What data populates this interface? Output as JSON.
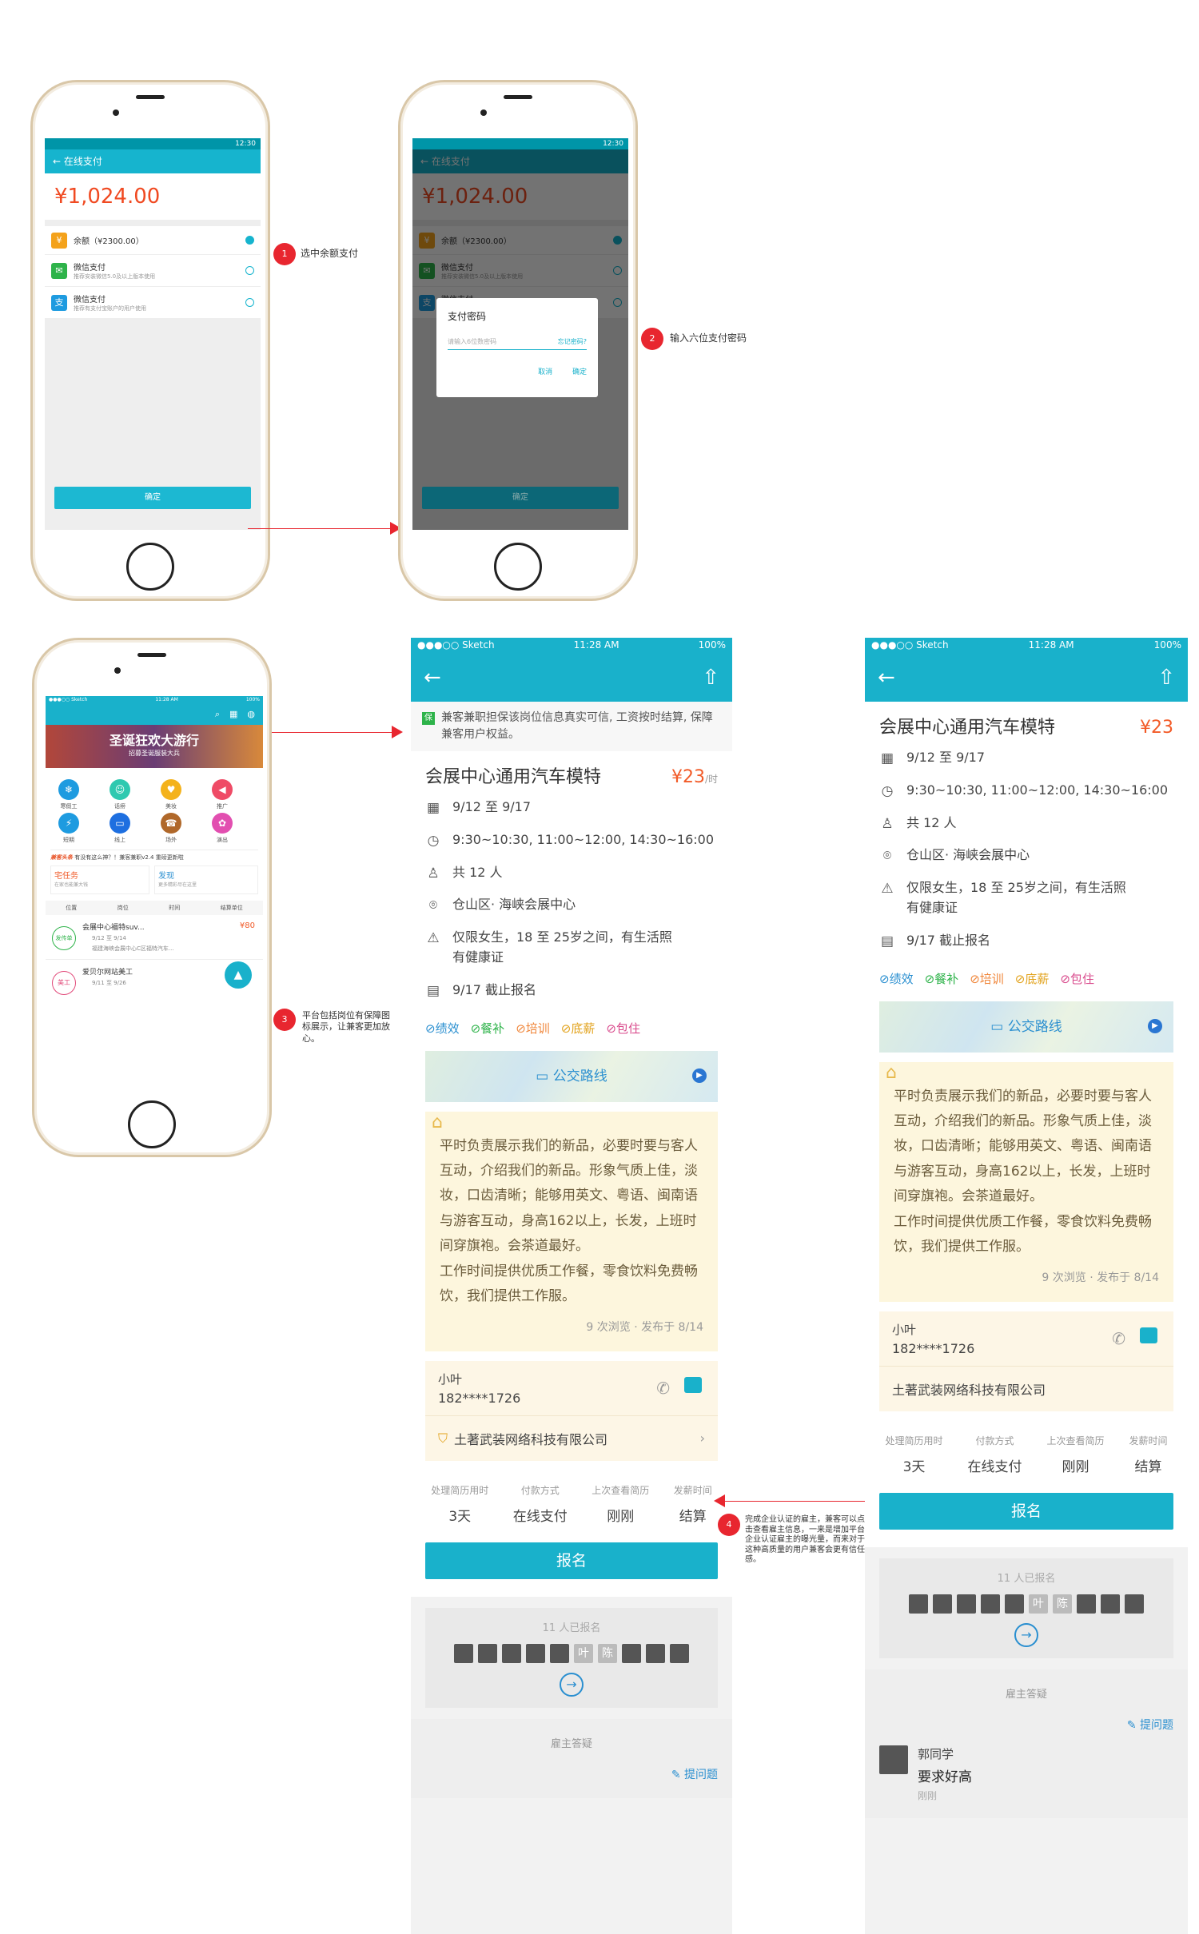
{
  "screen1": {
    "status_time": "12:30",
    "title": "在线支付",
    "amount": "¥1,024.00",
    "balance": "余额（¥2300.00）",
    "wechat": "微信支付",
    "wechat_sub": "推荐安装微信5.0及以上版本使用",
    "alipay": "微信支付",
    "alipay_sub": "推荐有支付宝账户的用户使用",
    "confirm": "确定"
  },
  "dialog": {
    "title": "支付密码",
    "placeholder": "请输入6位数密码",
    "forgot": "忘记密码?",
    "cancel": "取消",
    "ok": "确定"
  },
  "annotations": {
    "a1_num": "1",
    "a1": "选中余额支付",
    "a2_num": "2",
    "a2": "输入六位支付密码",
    "a3_num": "3",
    "a3": "平台包括岗位有保障图标展示，让兼客更加放心。",
    "a4_num": "4",
    "a4": "完成企业认证的雇主，兼客可以点击查看雇主信息，一来是增加平台企业认证雇主的曝光量，而来对于这种高质量的用户兼客会更有信任感。"
  },
  "home": {
    "status_left": "●●●○○ Sketch",
    "status_time": "11:28 AM",
    "status_batt": "100%",
    "banner": "圣诞狂欢大游行",
    "banner_sub": "招募圣诞服装大兵",
    "cats": [
      "寒假工",
      "话痨",
      "美妆",
      "推广",
      "短期",
      "线上",
      "场外",
      "演出"
    ],
    "headline_tag": "兼客头条",
    "headline": "有没有这么神？！兼客兼职v2.4 重磅更新啦",
    "zhai": "宅任务",
    "zhai_sub": "在家也能兼大钱",
    "faxian": "发现",
    "faxian_sub": "更多精彩尽在这里",
    "filters": [
      "位置",
      "岗位",
      "时间",
      "结算单位"
    ],
    "job1_title": "会展中心福特suv...",
    "job1_price": "¥80",
    "job1_date": "9/12 至 9/14",
    "job1_loc": "福建海峡会展中心C区福特汽车...",
    "job1_avatar": "发传单",
    "job2_title": "爱贝尔网站美工",
    "job2_date": "9/11 至 9/26",
    "job2_avatar": "美工"
  },
  "detail": {
    "status_left": "●●●○○ Sketch",
    "status_time": "11:28 AM",
    "status_batt": "100%",
    "guarantee": "兼客兼职担保该岗位信息真实可信, 工资按时结算, 保障兼客用户权益。",
    "guarantee_icon": "保",
    "title": "会展中心通用汽车模特",
    "price": "¥23",
    "price_unit": "/时",
    "date": "9/12 至 9/17",
    "time": "9:30~10:30, 11:00~12:00, 14:30~16:00",
    "people": "共 12 人",
    "location": "仓山区· 海峡会展中心",
    "req": "仅限女生，18 至 25岁之间，有生活照有健康证",
    "deadline": "9/17 截止报名",
    "tags": [
      "绩效",
      "餐补",
      "培训",
      "底薪",
      "包住"
    ],
    "tag_colors": [
      "#2a8fd0",
      "#2eb34a",
      "#f0863a",
      "#e2a21b",
      "#d94a8c"
    ],
    "map": "公交路线",
    "desc1": "平时负责展示我们的新品，必要时要与客人互动，介绍我们的新品。形象气质上佳，淡妆，口齿清晰；能够用英文、粤语、闽南语与游客互动，身高162以上，长发，上班时间穿旗袍。会茶道最好。",
    "desc2": "工作时间提供优质工作餐，零食饮料免费畅饮，我们提供工作服。",
    "meta": "9 次浏览 · 发布于 8/14",
    "contact_name": "小叶",
    "contact_phone": "182****1726",
    "company": "土著武装网络科技有限公司",
    "stats_labels": [
      "处理简历用时",
      "付款方式",
      "上次查看简历",
      "发薪时间"
    ],
    "stats_values": [
      "3天",
      "在线支付",
      "刚刚",
      "结算"
    ],
    "apply": "报名",
    "signed": "11 人已报名",
    "signed_txt": [
      "叶",
      "陈"
    ],
    "qa_title": "雇主答疑",
    "ask": "提问题",
    "qa_user": "郭同学",
    "qa_q": "要求好高",
    "qa_time": "刚刚"
  }
}
